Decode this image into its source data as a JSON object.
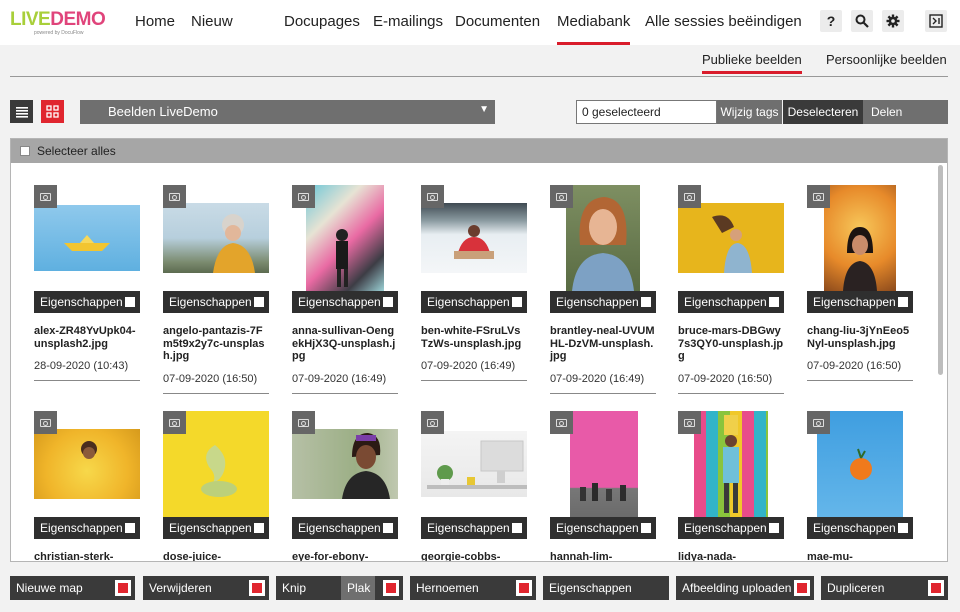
{
  "logo": {
    "part1": "LIVE",
    "part2": "DEMO",
    "tagline": "powered by DocuFlow"
  },
  "nav": {
    "items": [
      "Home",
      "Nieuw",
      "Docupages",
      "E-mailings",
      "Documenten",
      "Mediabank",
      "Alle sessies beëindigen"
    ],
    "active": "Mediabank",
    "icons": [
      {
        "name": "help-icon",
        "glyph": "?"
      },
      {
        "name": "search-icon",
        "glyph": "🔍"
      },
      {
        "name": "settings-gear-icon",
        "glyph": "⚙"
      },
      {
        "name": "logout-icon",
        "glyph": "⇥"
      }
    ]
  },
  "subtabs": {
    "public": "Publieke beelden",
    "personal": "Persoonlijke beelden",
    "active": "Publieke beelden"
  },
  "toolbar": {
    "folder": "Beelden LiveDemo",
    "selected": "0 geselecteerd",
    "change_tags": "Wijzig tags",
    "deselect": "Deselecteren",
    "share": "Delen"
  },
  "panel": {
    "select_all": "Selecteer alles",
    "props_label": "Eigenschappen"
  },
  "images_row1": [
    {
      "name": "alex-ZR48YvUpk04-unsplash2.jpg",
      "date": "28-09-2020 (10:43)"
    },
    {
      "name": "angelo-pantazis-7Fm5t9x2y7c-unsplash.jpg",
      "date": "07-09-2020 (16:50)"
    },
    {
      "name": "anna-sullivan-OengekHjX3Q-unsplash.jpg",
      "date": "07-09-2020 (16:49)"
    },
    {
      "name": "ben-white-FSruLVsTzWs-unsplash.jpg",
      "date": "07-09-2020 (16:49)"
    },
    {
      "name": "brantley-neal-UVUMHL-DzVM-unsplash.jpg",
      "date": "07-09-2020 (16:49)"
    },
    {
      "name": "bruce-mars-DBGwy7s3QY0-unsplash.jpg",
      "date": "07-09-2020 (16:50)"
    },
    {
      "name": "chang-liu-3jYnEeo5Nyl-unsplash.jpg",
      "date": "07-09-2020 (16:50)"
    }
  ],
  "images_row2": [
    {
      "name": "christian-sterk-"
    },
    {
      "name": "dose-juice-"
    },
    {
      "name": "eye-for-ebony-"
    },
    {
      "name": "georgie-cobbs-"
    },
    {
      "name": "hannah-lim-"
    },
    {
      "name": "lidya-nada-"
    },
    {
      "name": "mae-mu-"
    }
  ],
  "bottom": {
    "new_folder": "Nieuwe map",
    "delete": "Verwijderen",
    "cut": "Knip",
    "paste": "Plak",
    "rename": "Hernoemen",
    "properties": "Eigenschappen",
    "upload": "Afbeelding uploaden",
    "duplicate": "Dupliceren"
  }
}
